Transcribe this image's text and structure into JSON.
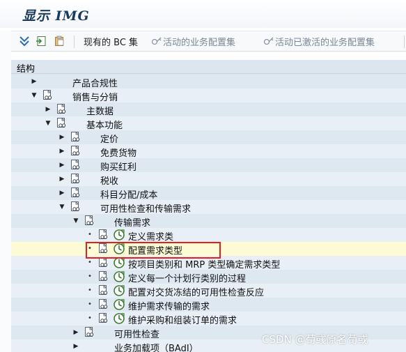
{
  "window": {
    "title": "显示 IMG"
  },
  "toolbar": {
    "current_bc_set": "现有的 BC 集",
    "active_bc_sets": "活动的业务配置集",
    "activated_bc_sets": "活动已激活的业务配置集"
  },
  "panel": {
    "header": "结构"
  },
  "tree": [
    {
      "label": "产品合规性",
      "indent": 0,
      "expander": "collapsed",
      "doc": false,
      "exec": false,
      "alt": false
    },
    {
      "label": "销售与分销",
      "indent": 0,
      "expander": "expanded",
      "doc": true,
      "exec": false,
      "alt": true
    },
    {
      "label": "主数据",
      "indent": 1,
      "expander": "collapsed",
      "doc": true,
      "exec": false,
      "alt": false
    },
    {
      "label": "基本功能",
      "indent": 1,
      "expander": "expanded",
      "doc": true,
      "exec": false,
      "alt": true
    },
    {
      "label": "定价",
      "indent": 2,
      "expander": "collapsed",
      "doc": true,
      "exec": false,
      "alt": false
    },
    {
      "label": "免费货物",
      "indent": 2,
      "expander": "collapsed",
      "doc": true,
      "exec": false,
      "alt": true
    },
    {
      "label": "购买红利",
      "indent": 2,
      "expander": "collapsed",
      "doc": true,
      "exec": false,
      "alt": false
    },
    {
      "label": "税收",
      "indent": 2,
      "expander": "collapsed",
      "doc": true,
      "exec": false,
      "alt": true
    },
    {
      "label": "科目分配/成本",
      "indent": 2,
      "expander": "collapsed",
      "doc": true,
      "exec": false,
      "alt": false
    },
    {
      "label": "可用性检查和传输需求",
      "indent": 2,
      "expander": "expanded",
      "doc": true,
      "exec": false,
      "alt": true
    },
    {
      "label": "传输需求",
      "indent": 3,
      "expander": "expanded",
      "doc": true,
      "exec": false,
      "alt": false
    },
    {
      "label": "定义需求类",
      "indent": 4,
      "expander": "bullet",
      "doc": true,
      "exec": true,
      "alt": true
    },
    {
      "label": "配置需求类型",
      "indent": 4,
      "expander": "bullet",
      "doc": true,
      "exec": true,
      "alt": false,
      "selected": true
    },
    {
      "label": "按项目类别和 MRP 类型确定需求类型",
      "indent": 4,
      "expander": "bullet",
      "doc": true,
      "exec": true,
      "alt": true
    },
    {
      "label": "定义每一个计划行类别的过程",
      "indent": 4,
      "expander": "bullet",
      "doc": true,
      "exec": true,
      "alt": false
    },
    {
      "label": "配置对交货冻结的可用性检查反应",
      "indent": 4,
      "expander": "bullet",
      "doc": true,
      "exec": true,
      "alt": true
    },
    {
      "label": "维护需求传输的需求",
      "indent": 4,
      "expander": "bullet",
      "doc": true,
      "exec": true,
      "alt": false
    },
    {
      "label": "维护采购和组装订单的需求",
      "indent": 4,
      "expander": "bullet",
      "doc": true,
      "exec": true,
      "alt": true
    },
    {
      "label": "可用性检查",
      "indent": 3,
      "expander": "collapsed",
      "doc": true,
      "exec": false,
      "alt": false
    },
    {
      "label": "业务加载项（BAdI）",
      "indent": 3,
      "expander": "collapsed",
      "doc": false,
      "exec": false,
      "alt": true
    }
  ],
  "watermark": "CSDN @荀彧原名荀或",
  "colors": {
    "selected_row": "#fcfbd4",
    "highlight_border": "#e0201c",
    "panel_bg": "#dee8f1"
  }
}
